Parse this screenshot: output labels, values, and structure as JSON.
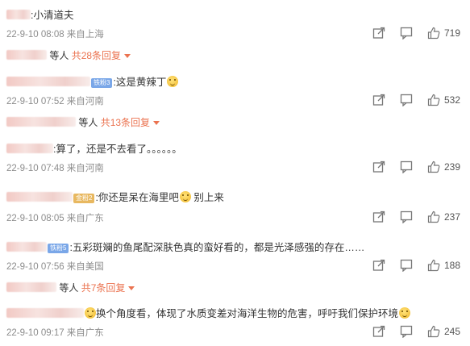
{
  "comments": [
    {
      "text": ":小清道夫",
      "meta": "22-9-10 08:08 来自上海",
      "likes": "719",
      "replies": {
        "suffix": "等人",
        "count": "共28条回复"
      }
    },
    {
      "badge": "铁粉3",
      "text": ":这是黄辣丁",
      "meta": "22-9-10 07:52 来自河南",
      "likes": "532",
      "replies": {
        "suffix": "等人",
        "count": "共13条回复"
      }
    },
    {
      "text": ":算了，还是不去看了。。。。。。",
      "meta": "22-9-10 07:48 来自河南",
      "likes": "239"
    },
    {
      "badge": "金粉2",
      "text": ":你还是呆在海里吧",
      "text2": "别上来",
      "meta": "22-9-10 08:05 来自广东",
      "likes": "237"
    },
    {
      "badge": "铁粉5",
      "text": ":五彩斑斓的鱼尾配深肤色真的蛮好看的，都是光泽感强的存在……",
      "meta": "22-9-10 07:56 来自美国",
      "likes": "188",
      "replies": {
        "suffix": "等人",
        "count": "共7条回复"
      }
    },
    {
      "text": "换个角度看，体现了水质变差对海洋生物的危害，呼吁我们保护环境",
      "meta": "22-9-10 09:17 来自广东",
      "likes": "245"
    }
  ],
  "icons": {
    "share": "share-icon",
    "comment": "comment-icon",
    "like": "thumbs-up-icon"
  },
  "colors": {
    "accent": "#eb7350",
    "meta": "#8d8d8d",
    "badge_blue": "#7aa7e8",
    "badge_gold": "#e8b860"
  }
}
